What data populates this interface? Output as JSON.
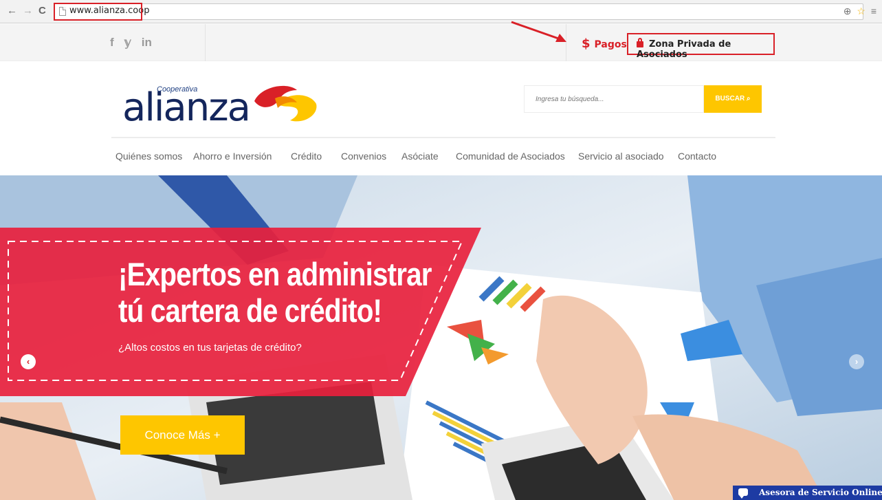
{
  "browser": {
    "back_icon": "←",
    "forward_icon": "→",
    "reload_icon": "C",
    "url": "www.alianza.coop",
    "zoom_icon": "⊕",
    "star_icon": "☆",
    "menu_icon": "≡"
  },
  "topbar": {
    "social": {
      "facebook": "f",
      "twitter": "𝕪",
      "linkedin": "in"
    },
    "pagos_symbol": "$",
    "pagos_label": "Pagos",
    "zona_label": "Zona Privada de Asociados",
    "accent_color": "#d92027"
  },
  "header": {
    "logo_small": "Cooperativa",
    "logo_main": "alianza",
    "search_placeholder": "Ingresa tu búsqueda...",
    "search_button": "BUSCAR ⌕"
  },
  "menu": [
    "Quiénes somos",
    "Ahorro e Inversión",
    "Crédito",
    "Convenios",
    "Asóciate",
    "Comunidad de Asociados",
    "Servicio al asociado",
    "Contacto"
  ],
  "hero": {
    "title_line1": "¡Expertos en administrar",
    "title_line2": "tú cartera de crédito!",
    "subtitle": "¿Altos costos en tus tarjetas de crédito?",
    "cta": "Conoce Más +",
    "prev_icon": "‹",
    "next_icon": "›",
    "accent_color": "#e8213d",
    "cta_color": "#fec600"
  },
  "chat": {
    "label": "Asesora de Servicio Online"
  }
}
